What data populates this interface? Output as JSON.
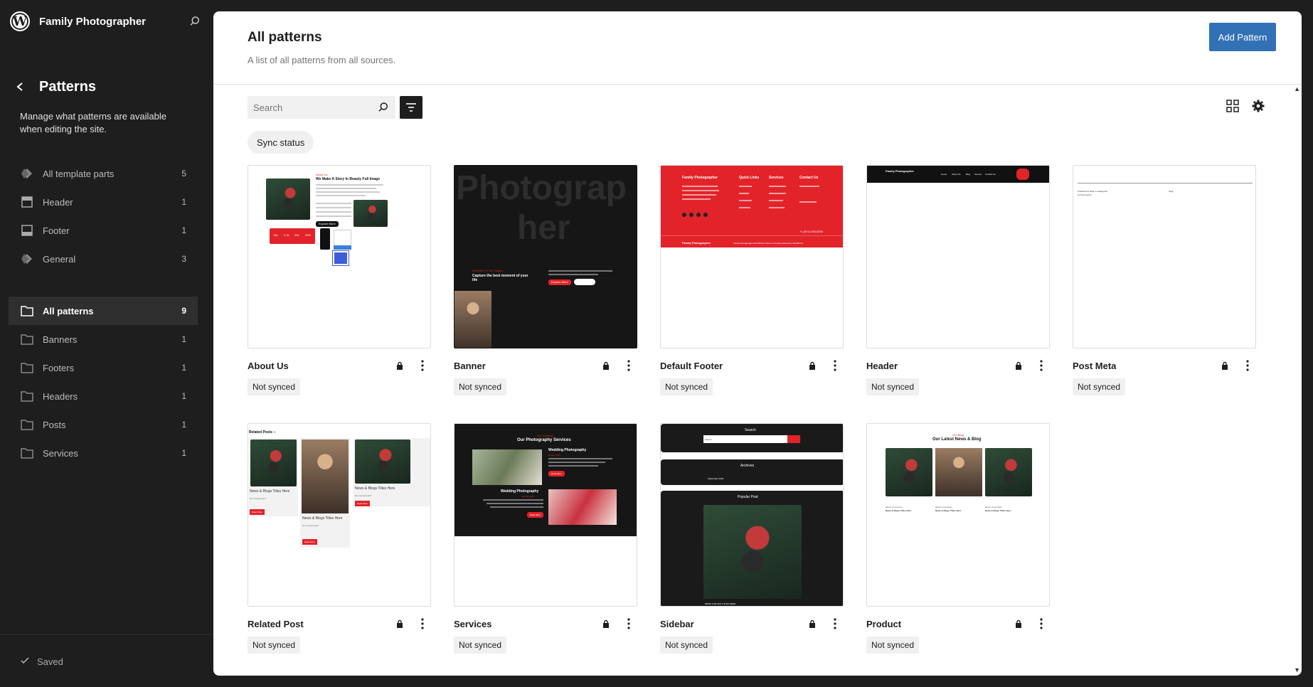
{
  "site": {
    "name": "Family Photographer"
  },
  "sidebar": {
    "title": "Patterns",
    "description": "Manage what patterns are available when editing the site.",
    "template_parts": [
      {
        "label": "All template parts",
        "count": "5",
        "icon": "diamond-icon"
      },
      {
        "label": "Header",
        "count": "1",
        "icon": "header-layout-icon"
      },
      {
        "label": "Footer",
        "count": "1",
        "icon": "footer-layout-icon"
      },
      {
        "label": "General",
        "count": "3",
        "icon": "diamond-icon"
      }
    ],
    "categories": [
      {
        "label": "All patterns",
        "count": "9",
        "icon": "folder-icon",
        "active": true
      },
      {
        "label": "Banners",
        "count": "1",
        "icon": "folder-icon"
      },
      {
        "label": "Footers",
        "count": "1",
        "icon": "folder-icon"
      },
      {
        "label": "Headers",
        "count": "1",
        "icon": "folder-icon"
      },
      {
        "label": "Posts",
        "count": "1",
        "icon": "folder-icon"
      },
      {
        "label": "Services",
        "count": "1",
        "icon": "folder-icon"
      }
    ],
    "status": "Saved"
  },
  "main": {
    "title": "All patterns",
    "description": "A list of all patterns from all sources.",
    "add_button": "Add Pattern",
    "search_placeholder": "Search",
    "filter_pill": "Sync status",
    "patterns": [
      {
        "title": "About Us",
        "status": "Not synced"
      },
      {
        "title": "Banner",
        "status": "Not synced"
      },
      {
        "title": "Default Footer",
        "status": "Not synced"
      },
      {
        "title": "Header",
        "status": "Not synced"
      },
      {
        "title": "Post Meta",
        "status": "Not synced"
      },
      {
        "title": "Related Post",
        "status": "Not synced"
      },
      {
        "title": "Services",
        "status": "Not synced"
      },
      {
        "title": "Sidebar",
        "status": "Not synced"
      },
      {
        "title": "Product",
        "status": "Not synced"
      }
    ]
  },
  "previews": {
    "about": {
      "heading": "About Us",
      "title": "We Make A Story In Beauty Full Image",
      "button": "Explore More",
      "stats": [
        "15k",
        "3.1k",
        "20k",
        "99%"
      ]
    },
    "banner": {
      "bg_text_1": "Photograp",
      "bg_text_2": "her",
      "kicker": "Welcome To Our Gallery",
      "headline": "Capture the best moment of your life",
      "button": "Explore More"
    },
    "footer": {
      "brand": "Family Photographer",
      "cols": [
        "Quick Links",
        "Services",
        "Contact Us"
      ],
      "bottom": "Family Photographer",
      "copyright": "Family Photographer WordPress Theme | Proudly powered by WordPress",
      "phone": "+1 (572) 000-0293"
    },
    "header": {
      "brand": "Family Photographer",
      "menu": [
        "Home",
        "About Us",
        "Blog",
        "Service",
        "Contact Us"
      ],
      "button": "Explore More"
    },
    "postmeta": {
      "line1": "Posted Post Date in Categories",
      "line2": "by Post Author",
      "tags": "Tags:"
    },
    "related": {
      "heading": "Related Posts :-",
      "item_title": "News & Blogs Titles Here",
      "excerpt": "No excerpt found",
      "button": "Read More"
    },
    "services": {
      "kicker": "Our Services",
      "heading": "Our Photography Services",
      "s1": "Wedding Photography",
      "s2": "Wedding Photography",
      "price": "$0 Day 2025",
      "button": "Read More"
    },
    "sidebar": {
      "search": "Search",
      "search_ph": "Search",
      "archives": "Archives",
      "archive_item": "September 2025",
      "popular": "Popular Post",
      "caption": "NEWS & BLOGS TITLES HERE"
    },
    "product": {
      "kicker": "Our Blog",
      "heading": "Our Latest News & Blog",
      "item_title": "News & Blogs Titles Here",
      "meta": "admin  Comments"
    }
  }
}
